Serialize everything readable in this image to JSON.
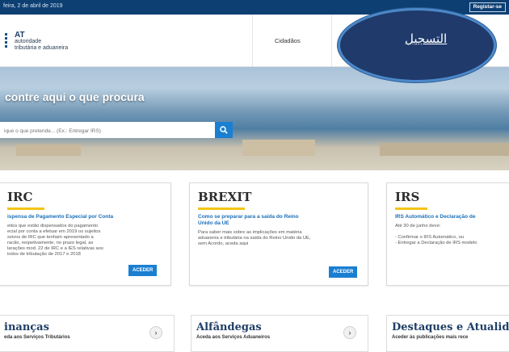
{
  "topbar": {
    "date": "feira, 2 de abril de 2019",
    "register_label": "Registar-se"
  },
  "header": {
    "logo_at": "AT",
    "logo_line1": "autoridade",
    "logo_line2": "tributária e aduaneira",
    "nav_cidadaos": "Cidadãos"
  },
  "overlay": {
    "label": "التسجيل"
  },
  "hero": {
    "title": "contre aqui o que procura",
    "search_placeholder": "ique o que pretende... (Ex.: Entregar IRS)"
  },
  "cards": [
    {
      "title": "IRC",
      "subtitle_l1": "ispensa de Pagamento Especial por Conta",
      "body": [
        "eitos que estão dispensados do pagamento",
        "ecial por conta a efetuar em 2019 os sujeitos",
        "ssivos de IRC que tenham apresentado a",
        "racão, respetivamente, no prazo legal, as",
        "larações mod. 22 de IRC e a IES relativas aos",
        "iodos de tributação de 2017 e 2018"
      ],
      "button": "ACEDER"
    },
    {
      "title": "BREXIT",
      "subtitle_l1": "Como se preparar para a saída do Reino",
      "subtitle_l2": "Unido da UE",
      "body": [
        "Para saber mais sobre as implicações em matéria",
        "aduaneira e tributária na saída do Reino Unido da UE,",
        "sem Acordo, aceda aqui"
      ],
      "button": "ACEDER"
    },
    {
      "title": "IRS",
      "subtitle_l1": "IRS Automático e Declaração de",
      "body": [
        "Até 30 de junho deve:",
        "",
        "- Confirmar o IRS Automático, ou",
        "- Entregar a Declaração de IRS modelo"
      ]
    }
  ],
  "bottom_cards": [
    {
      "title": "inanças",
      "subtitle": "eda aos Serviços Tributários",
      "arrow": "›"
    },
    {
      "title": "Alfândegas",
      "subtitle": "Aceda aos Serviços Aduaneiros",
      "arrow": "›"
    },
    {
      "title": "Destaques e Atualida",
      "subtitle": "Aceder às publicações mais rece"
    }
  ],
  "colors": {
    "navy": "#0d3f73",
    "accent_blue": "#1a7fd1",
    "yellow_bar": "#f3c417",
    "overlay_fill": "#1f3a6b"
  }
}
